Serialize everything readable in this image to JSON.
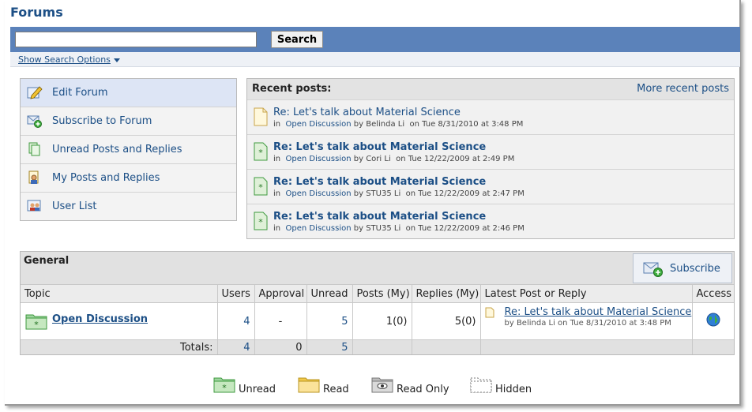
{
  "page": {
    "title": "Forums"
  },
  "search": {
    "button_label": "Search",
    "input_value": "",
    "options_label": "Show Search Options"
  },
  "sidebar": {
    "items": [
      {
        "label": "Edit Forum",
        "icon": "pencil-icon"
      },
      {
        "label": "Subscribe to Forum",
        "icon": "subscribe-envelope-icon"
      },
      {
        "label": "Unread Posts and Replies",
        "icon": "unread-pages-icon"
      },
      {
        "label": "My Posts and Replies",
        "icon": "my-posts-icon"
      },
      {
        "label": "User List",
        "icon": "users-icon"
      }
    ]
  },
  "recent": {
    "heading": "Recent posts:",
    "more_label": "More recent posts",
    "in_label": "in",
    "by_label": "by",
    "on_label": "on",
    "posts": [
      {
        "title": "Re: Let's talk about Material Science",
        "forum": "Open Discussion",
        "author": "Belinda Li",
        "date": "Tue 8/31/2010 at 3:48 PM",
        "read": true
      },
      {
        "title": "Re: Let's talk about Material Science",
        "forum": "Open Discussion",
        "author": "Cori Li",
        "date": "Tue 12/22/2009 at 2:49 PM",
        "read": false
      },
      {
        "title": "Re: Let's talk about Material Science",
        "forum": "Open Discussion",
        "author": "STU35 Li",
        "date": "Tue 12/22/2009 at 2:47 PM",
        "read": false
      },
      {
        "title": "Re: Let's talk about Material Science",
        "forum": "Open Discussion",
        "author": "STU35 Li",
        "date": "Tue 12/22/2009 at 2:46 PM",
        "read": false
      }
    ]
  },
  "general": {
    "heading": "General",
    "subscribe_label": "Subscribe",
    "columns": [
      "Topic",
      "Users",
      "Approval",
      "Unread",
      "Posts (My)",
      "Replies (My)",
      "Latest Post or Reply",
      "Access"
    ],
    "rows": [
      {
        "topic": "Open Discussion",
        "users": "4",
        "approval": "-",
        "unread": "5",
        "posts": "1(0)",
        "replies": "5(0)",
        "latest_title": "Re: Let's talk about Material Science",
        "latest_meta": "by Belinda Li  on Tue 8/31/2010 at 3:48 PM"
      }
    ],
    "totals": {
      "label": "Totals:",
      "users": "4",
      "approval": "0",
      "unread": "5"
    }
  },
  "legend": [
    {
      "label": "Unread",
      "icon": "folder-unread-icon"
    },
    {
      "label": "Read",
      "icon": "folder-read-icon"
    },
    {
      "label": "Read Only",
      "icon": "folder-readonly-icon"
    },
    {
      "label": "Hidden",
      "icon": "folder-hidden-icon"
    }
  ],
  "colors": {
    "header_bar": "#5b82ba",
    "link": "#1c4f86",
    "unread_green": "#3f9a3f",
    "folder_read": "#f7d565"
  }
}
